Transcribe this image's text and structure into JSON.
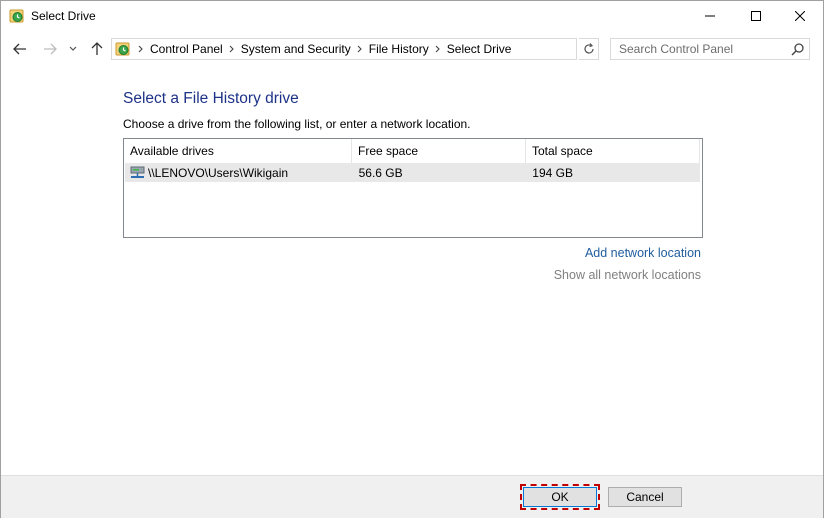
{
  "window": {
    "title": "Select Drive",
    "icon": "file-history-icon",
    "controls": [
      "minimize-icon",
      "maximize-icon",
      "close-icon"
    ]
  },
  "navigation": {
    "breadcrumbs": [
      "Control Panel",
      "System and Security",
      "File History",
      "Select Drive"
    ],
    "search_placeholder": "Search Control Panel"
  },
  "main": {
    "heading": "Select a File History drive",
    "instruction": "Choose a drive from the following list, or enter a network location.",
    "table": {
      "columns": [
        "Available drives",
        "Free space",
        "Total space"
      ],
      "rows": [
        {
          "name": "\\\\LENOVO\\Users\\Wikigain",
          "free": "56.6 GB",
          "total": "194 GB",
          "icon": "network-drive-icon"
        }
      ]
    },
    "links": {
      "add": "Add network location",
      "show_all": "Show all network locations"
    }
  },
  "footer": {
    "ok_label": "OK",
    "cancel_label": "Cancel"
  },
  "colors": {
    "heading": "#1e3287",
    "link": "#1f5d9e",
    "link_disabled": "#808080",
    "focus_highlight": "#c00000"
  }
}
